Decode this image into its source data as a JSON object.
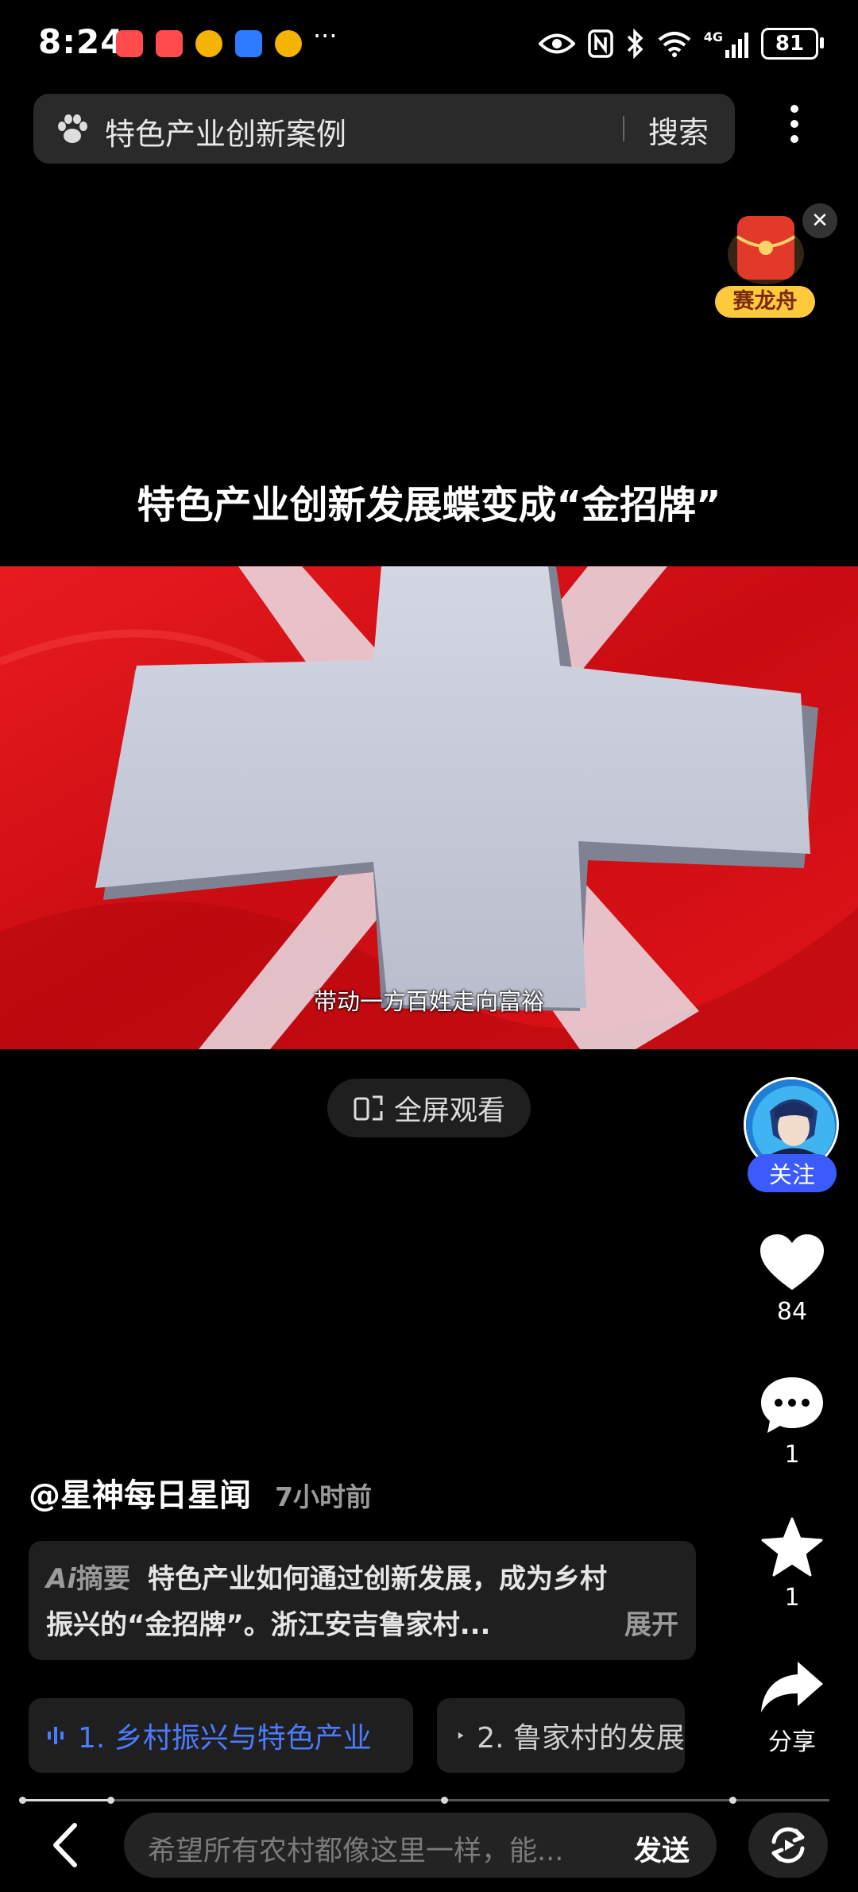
{
  "status_bar": {
    "time": "8:24",
    "network": "4G",
    "battery": "81",
    "more": "···"
  },
  "search": {
    "query": "特色产业创新案例",
    "button_label": "搜索"
  },
  "promo": {
    "label": "赛龙舟"
  },
  "video": {
    "title": "特色产业创新发展蝶变成“金招牌”",
    "subtitle": "带动一方百姓走向富裕",
    "fullscreen_label": "全屏观看"
  },
  "actions": {
    "follow_label": "关注",
    "like_count": "84",
    "comment_count": "1",
    "favorite_count": "1",
    "share_label": "分享"
  },
  "post": {
    "author": "@星神每日星闻",
    "time_ago": "7小时前"
  },
  "ai_summary": {
    "label": "摘要",
    "line1": "特色产业如何通过创新发展，成为乡村",
    "line2": "振兴的“金招牌”。浙江安吉鲁家村...",
    "expand_label": "展开"
  },
  "chapters": [
    {
      "label": "1. 乡村振兴与特色产业",
      "active": true
    },
    {
      "label": "2. 鲁家村的发展",
      "active": false
    }
  ],
  "progress": 0.11,
  "comment": {
    "placeholder": "希望所有农村都像这里一样，能...",
    "send_label": "发送"
  },
  "colors": {
    "accent": "#3b5bfd",
    "chapter_active": "#4d7bff",
    "video_red": "#d60d14"
  },
  "icons": [
    "paw-icon",
    "more-vertical-icon",
    "heart-icon",
    "comment-icon",
    "star-icon",
    "share-icon",
    "back-icon",
    "replay-icon",
    "fullscreen-icon",
    "wave-icon",
    "play-icon"
  ]
}
